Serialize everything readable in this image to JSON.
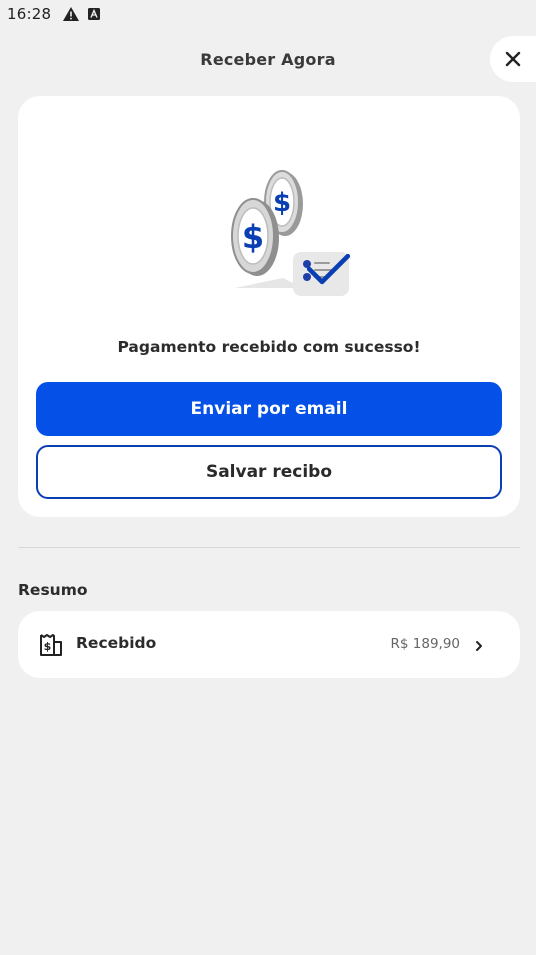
{
  "status_bar": {
    "time": "16:28"
  },
  "header": {
    "title": "Receber Agora"
  },
  "card": {
    "success_message": "Pagamento recebido com sucesso!",
    "primary_button": "Enviar por email",
    "secondary_button": "Salvar recibo"
  },
  "summary": {
    "section_title": "Resumo",
    "items": [
      {
        "label": "Recebido",
        "value": "R$ 189,90",
        "icon": "receipt-dollar-icon"
      }
    ]
  },
  "colors": {
    "background": "#f0f0f0",
    "primary": "#0550e6",
    "primary_border": "#0a3fb4",
    "surface": "#ffffff"
  }
}
